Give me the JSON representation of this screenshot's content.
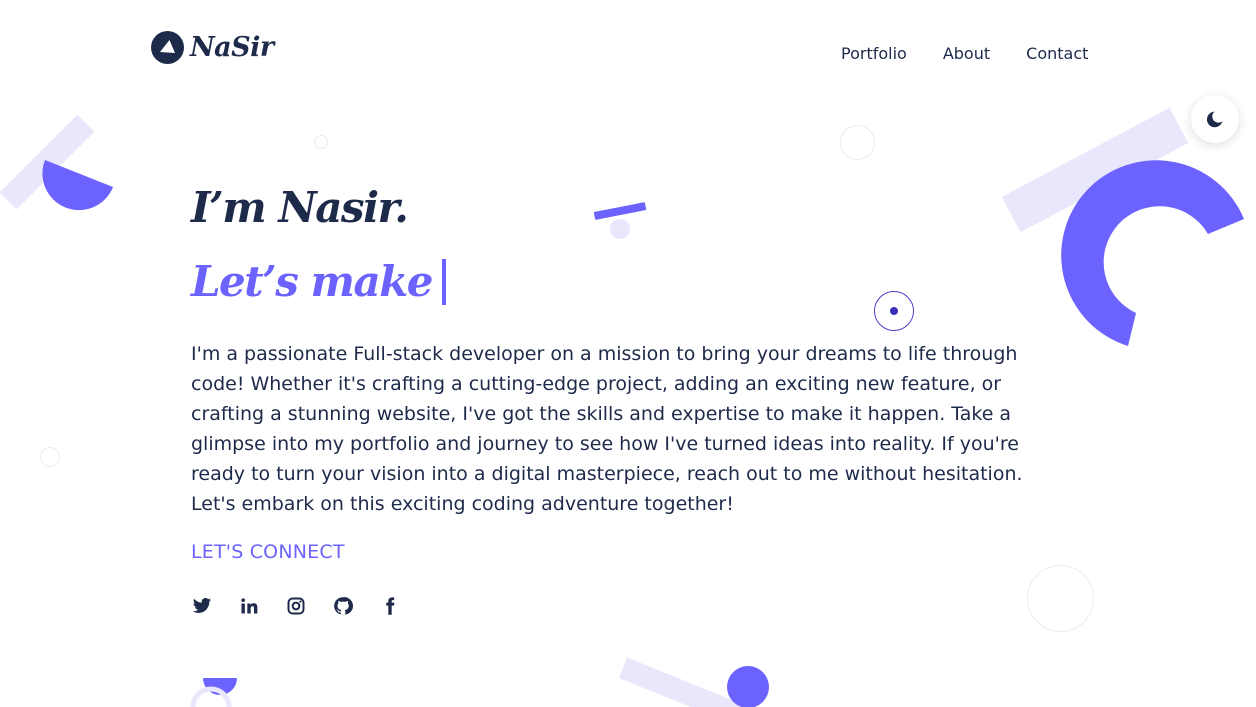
{
  "brand": {
    "logo_text": "NaSir"
  },
  "nav": {
    "items": [
      {
        "label": "Portfolio"
      },
      {
        "label": "About"
      },
      {
        "label": "Contact"
      }
    ]
  },
  "theme_toggle": {
    "icon": "moon-icon"
  },
  "hero": {
    "intro": "I’m Nasir.",
    "typed_text": "Let’s make",
    "description": "I'm a passionate Full-stack developer on a mission to bring your dreams to life through code! Whether it's crafting a cutting-edge project, adding an exciting new feature, or crafting a stunning website, I've got the skills and expertise to make it happen. Take a glimpse into my portfolio and journey to see how I've turned ideas into reality. If you're ready to turn your vision into a digital masterpiece, reach out to me without hesitation. Let's embark on this exciting coding adventure together!",
    "connect_label": "LET'S CONNECT"
  },
  "socials": [
    {
      "icon": "twitter-icon"
    },
    {
      "icon": "linkedin-icon"
    },
    {
      "icon": "instagram-icon"
    },
    {
      "icon": "github-icon"
    },
    {
      "icon": "facebook-icon"
    }
  ],
  "colors": {
    "accent": "#6c63ff",
    "text": "#1e2a4a",
    "lavender": "#e9e7fc",
    "background": "#ffffff"
  }
}
